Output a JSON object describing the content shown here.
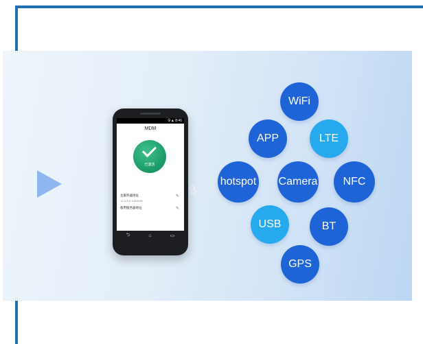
{
  "banner": {
    "watermark": "218"
  },
  "phone": {
    "status": "令▲ 8:46",
    "title": "MDM",
    "check_label": "已激活",
    "settings": [
      {
        "label": "主服务器地址",
        "value": "10.110.6.108:8080"
      },
      {
        "label": "备用服务器地址",
        "value": ""
      }
    ],
    "nav": {
      "back": "⮌",
      "home": "⌂",
      "recent": "▭"
    }
  },
  "features": {
    "wifi": "WiFi",
    "app": "APP",
    "lte": "LTE",
    "hotspot": "hotspot",
    "camera": "Camera",
    "nfc": "NFC",
    "usb": "USB",
    "bt": "BT",
    "gps": "GPS"
  },
  "colors": {
    "frame": "#1e6fb3",
    "bubble_dark": "#1f64d6",
    "bubble_light": "#27a9ee",
    "check_green": "#1f9e6c"
  }
}
